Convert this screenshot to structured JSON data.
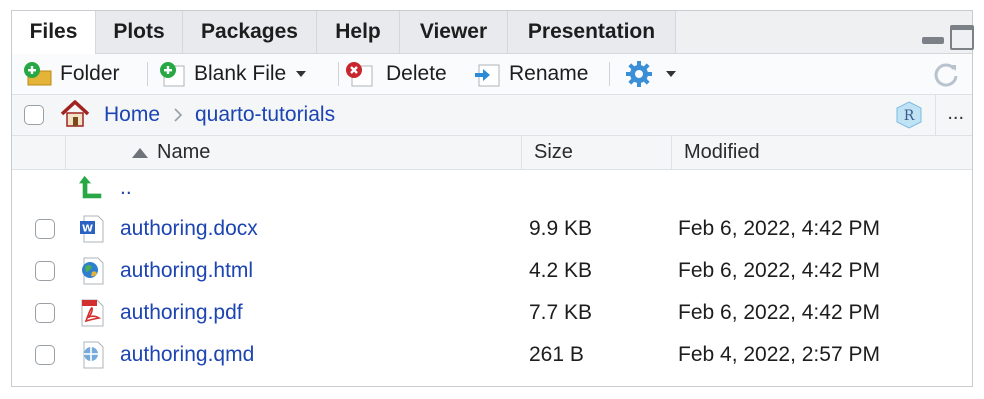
{
  "tabs": [
    {
      "label": "Files",
      "active": true
    },
    {
      "label": "Plots",
      "active": false
    },
    {
      "label": "Packages",
      "active": false
    },
    {
      "label": "Help",
      "active": false
    },
    {
      "label": "Viewer",
      "active": false
    },
    {
      "label": "Presentation",
      "active": false
    }
  ],
  "toolbar": {
    "new_folder": "Folder",
    "blank_file": "Blank File",
    "delete": "Delete",
    "rename": "Rename",
    "more_icon": "gear-icon",
    "refresh_icon": "refresh-icon"
  },
  "breadcrumb": {
    "home": "Home",
    "separator": ">",
    "current": "quarto-tutorials",
    "overflow": "..."
  },
  "columns": {
    "name": "Name",
    "size": "Size",
    "modified": "Modified"
  },
  "parent_link": "..",
  "files": [
    {
      "name": "authoring.docx",
      "size": "9.9 KB",
      "modified": "Feb 6, 2022, 4:42 PM",
      "icon": "word-doc-icon"
    },
    {
      "name": "authoring.html",
      "size": "4.2 KB",
      "modified": "Feb 6, 2022, 4:42 PM",
      "icon": "html-globe-icon"
    },
    {
      "name": "authoring.pdf",
      "size": "7.7 KB",
      "modified": "Feb 6, 2022, 4:42 PM",
      "icon": "pdf-icon"
    },
    {
      "name": "authoring.qmd",
      "size": "261 B",
      "modified": "Feb 4, 2022, 2:57 PM",
      "icon": "quarto-icon"
    }
  ],
  "colors": {
    "link": "#1c44b2",
    "accent_green": "#27a844",
    "delete_red": "#c8252d"
  }
}
